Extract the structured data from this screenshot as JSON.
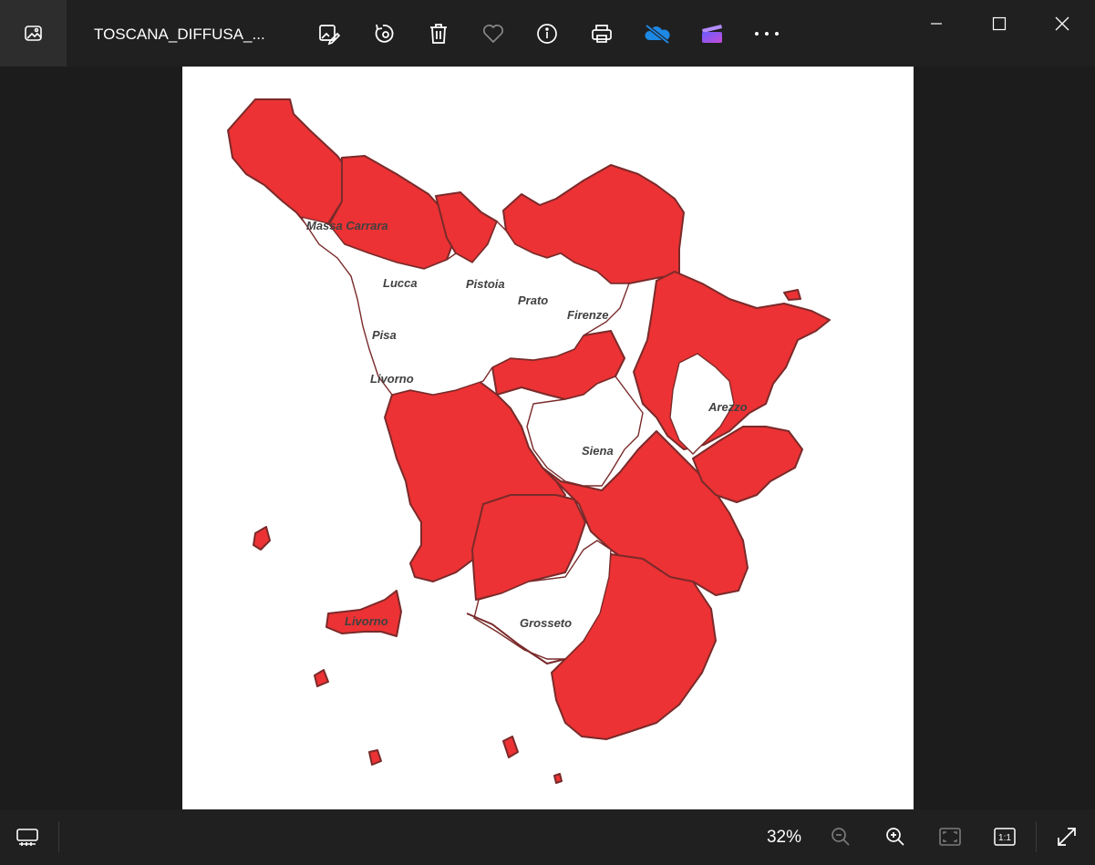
{
  "window": {
    "title": "TOSCANA_DIFFUSA_...",
    "app_icon": "photos-app-icon"
  },
  "toolbar": {
    "items": [
      {
        "name": "edit-image-icon"
      },
      {
        "name": "rotate-icon"
      },
      {
        "name": "delete-icon"
      },
      {
        "name": "favorite-heart-icon"
      },
      {
        "name": "info-icon"
      },
      {
        "name": "print-icon"
      },
      {
        "name": "onedrive-off-icon"
      },
      {
        "name": "video-editor-icon"
      },
      {
        "name": "more-options-icon"
      }
    ]
  },
  "window_controls": [
    "minimize-icon",
    "maximize-icon",
    "close-icon"
  ],
  "map": {
    "labels": {
      "massa_carrara": "Massa Carrara",
      "lucca": "Lucca",
      "pistoia": "Pistoia",
      "prato": "Prato",
      "firenze": "Firenze",
      "pisa": "Pisa",
      "livorno": "Livorno",
      "arezzo": "Arezzo",
      "siena": "Siena",
      "livorno_island": "Livorno",
      "grosseto": "Grosseto"
    },
    "colors": {
      "highlight": "#ec3234",
      "border": "#7a2a2a",
      "background": "#ffffff"
    }
  },
  "bottombar": {
    "zoom_level": "32%"
  }
}
